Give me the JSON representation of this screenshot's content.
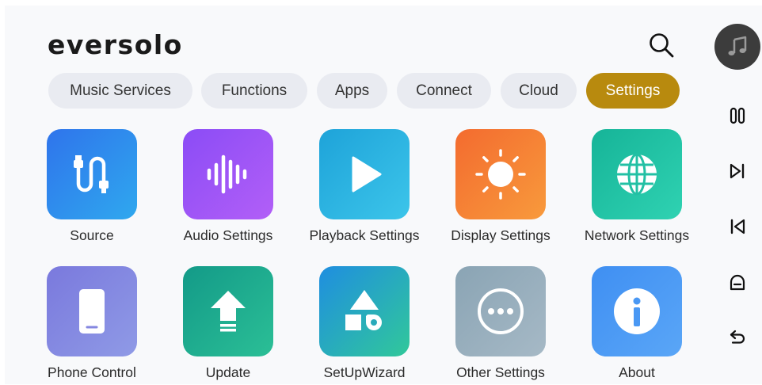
{
  "app": {
    "logo_text": "eversolo"
  },
  "search": {
    "icon": "search-icon"
  },
  "tabs": [
    {
      "label": "Music Services",
      "active": false
    },
    {
      "label": "Functions",
      "active": false
    },
    {
      "label": "Apps",
      "active": false
    },
    {
      "label": "Connect",
      "active": false
    },
    {
      "label": "Cloud",
      "active": false
    },
    {
      "label": "Settings",
      "active": true
    }
  ],
  "settings_tiles": [
    {
      "label": "Source",
      "icon": "cable-icon",
      "gradient": [
        "#2f74ec",
        "#2fa8ee"
      ]
    },
    {
      "label": "Audio Settings",
      "icon": "waveform-icon",
      "gradient": [
        "#8b4cf6",
        "#b25ff7"
      ]
    },
    {
      "label": "Playback Settings",
      "icon": "play-icon",
      "gradient": [
        "#1ea3d9",
        "#3cc5ea"
      ]
    },
    {
      "label": "Display Settings",
      "icon": "sun-icon",
      "gradient": [
        "#f36b2f",
        "#f89a3c"
      ]
    },
    {
      "label": "Network Settings",
      "icon": "globe-icon",
      "gradient": [
        "#16b498",
        "#2fd2b2"
      ]
    },
    {
      "label": "Phone Control",
      "icon": "phone-icon",
      "gradient": [
        "#7a79dd",
        "#8f9ae6"
      ]
    },
    {
      "label": "Update",
      "icon": "upload-arrow-icon",
      "gradient": [
        "#139a88",
        "#2bbf96"
      ]
    },
    {
      "label": "SetUpWizard",
      "icon": "shapes-icon",
      "gradient": [
        "#1f8ee0",
        "#31c89a"
      ]
    },
    {
      "label": "Other Settings",
      "icon": "more-icon",
      "gradient": [
        "#8aa4b4",
        "#a6b9c6"
      ]
    },
    {
      "label": "About",
      "icon": "info-icon",
      "gradient": [
        "#3f8ff2",
        "#5aa6f7"
      ]
    }
  ],
  "sidebar": {
    "now_playing_icon": "music-note-icon",
    "buttons": [
      {
        "icon": "pause-icon"
      },
      {
        "icon": "next-track-icon"
      },
      {
        "icon": "previous-track-icon"
      },
      {
        "icon": "home-icon"
      },
      {
        "icon": "back-icon"
      }
    ]
  },
  "colors": {
    "active_tab": "#b88a0e",
    "tab_bg": "#e9ebf1",
    "background": "#f8f9fb"
  }
}
